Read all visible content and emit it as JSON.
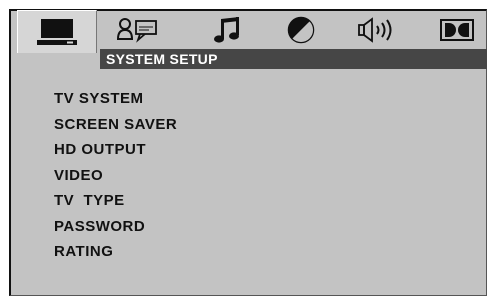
{
  "tabs": [
    {
      "icon": "monitor-icon",
      "active": true
    },
    {
      "icon": "user-subtitle-icon",
      "active": false
    },
    {
      "icon": "music-note-icon",
      "active": false
    },
    {
      "icon": "contrast-icon",
      "active": false
    },
    {
      "icon": "speaker-icon",
      "active": false
    },
    {
      "icon": "dolby-icon",
      "active": false
    }
  ],
  "header": {
    "title": "SYSTEM SETUP"
  },
  "menu": {
    "items": [
      "TV SYSTEM",
      "SCREEN SAVER",
      "HD OUTPUT",
      "VIDEO",
      "TV  TYPE",
      "PASSWORD",
      "RATING"
    ]
  },
  "colors": {
    "frame_bg": "#c3c3c3",
    "header_bg": "#464646",
    "header_text": "#ffffff",
    "item_text": "#111111"
  }
}
